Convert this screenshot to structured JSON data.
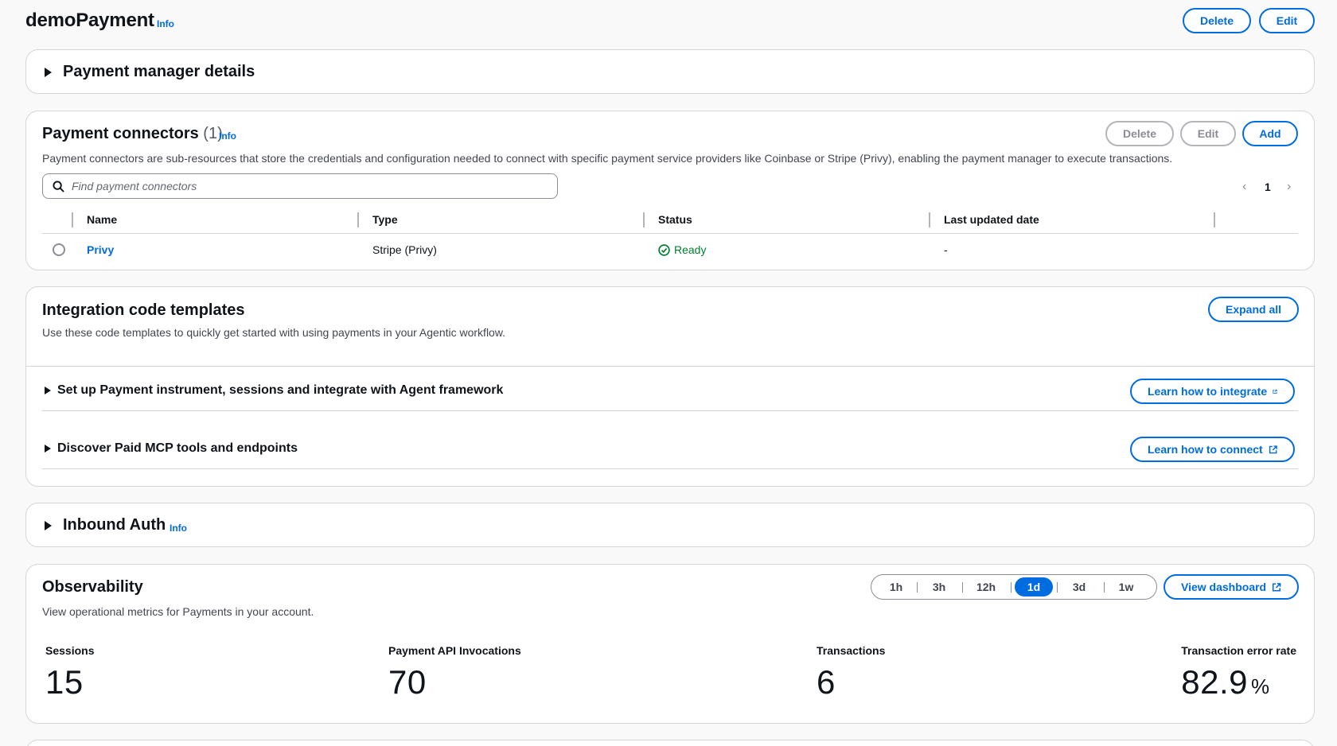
{
  "header": {
    "title": "demoPayment",
    "info": "Info",
    "delete_label": "Delete",
    "edit_label": "Edit"
  },
  "manager_details": {
    "title": "Payment manager details"
  },
  "connectors": {
    "title": "Payment connectors",
    "count": "(1)",
    "info": "Info",
    "delete_label": "Delete",
    "edit_label": "Edit",
    "add_label": "Add",
    "description": "Payment connectors are sub-resources that store the credentials and configuration needed to connect with specific payment service providers like Coinbase or Stripe (Privy), enabling the payment manager to execute transactions.",
    "search_placeholder": "Find payment connectors",
    "page": "1",
    "columns": [
      "Name",
      "Type",
      "Status",
      "Last updated date"
    ],
    "rows": [
      {
        "name": "Privy",
        "type": "Stripe (Privy)",
        "status": "Ready",
        "last_updated": "-"
      }
    ]
  },
  "integration": {
    "title": "Integration code templates",
    "description": "Use these code templates to quickly get started with using payments in your Agentic workflow.",
    "expand_all_label": "Expand all",
    "sections": [
      {
        "label": "Set up Payment instrument, sessions and integrate with Agent framework",
        "button": "Learn how to integrate"
      },
      {
        "label": "Discover Paid MCP tools and endpoints",
        "button": "Learn how to connect"
      }
    ]
  },
  "inbound_auth": {
    "title": "Inbound Auth",
    "info": "Info"
  },
  "observability": {
    "title": "Observability",
    "description": "View operational metrics for Payments in your account.",
    "ranges": [
      "1h",
      "3h",
      "12h",
      "1d",
      "3d",
      "1w"
    ],
    "selected_range": "1d",
    "dashboard_label": "View dashboard",
    "metrics": [
      {
        "label": "Sessions",
        "value": "15",
        "unit": ""
      },
      {
        "label": "Payment API Invocations",
        "value": "70",
        "unit": ""
      },
      {
        "label": "Transactions",
        "value": "6",
        "unit": ""
      },
      {
        "label": "Transaction error rate",
        "value": "82.9",
        "unit": "%"
      }
    ]
  },
  "colors": {
    "accent": "#006ce0",
    "success": "#00802f",
    "border": "#d5d5da"
  }
}
